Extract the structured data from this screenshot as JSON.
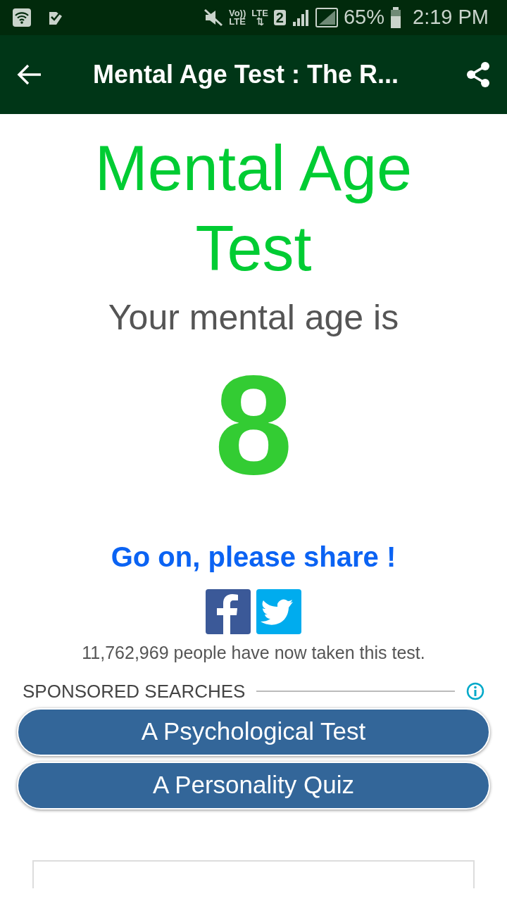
{
  "status_bar": {
    "badges": [
      {
        "top": "Vo))",
        "bottom": "LTE"
      },
      {
        "top": "LTE",
        "bottom": "⇅"
      }
    ],
    "sim": "2",
    "battery": "65%",
    "time": "2:19 PM"
  },
  "app_bar": {
    "title": "Mental Age Test : The R..."
  },
  "heading": "Mental Age Test",
  "subtitle": "Your mental age is",
  "result": "8",
  "share_prompt": "Go on, please share !",
  "count_text": "11,762,969 people have now taken this test.",
  "sponsored": {
    "label": "SPONSORED SEARCHES",
    "buttons": [
      "A Psychological Test",
      "A Personality Quiz"
    ]
  }
}
